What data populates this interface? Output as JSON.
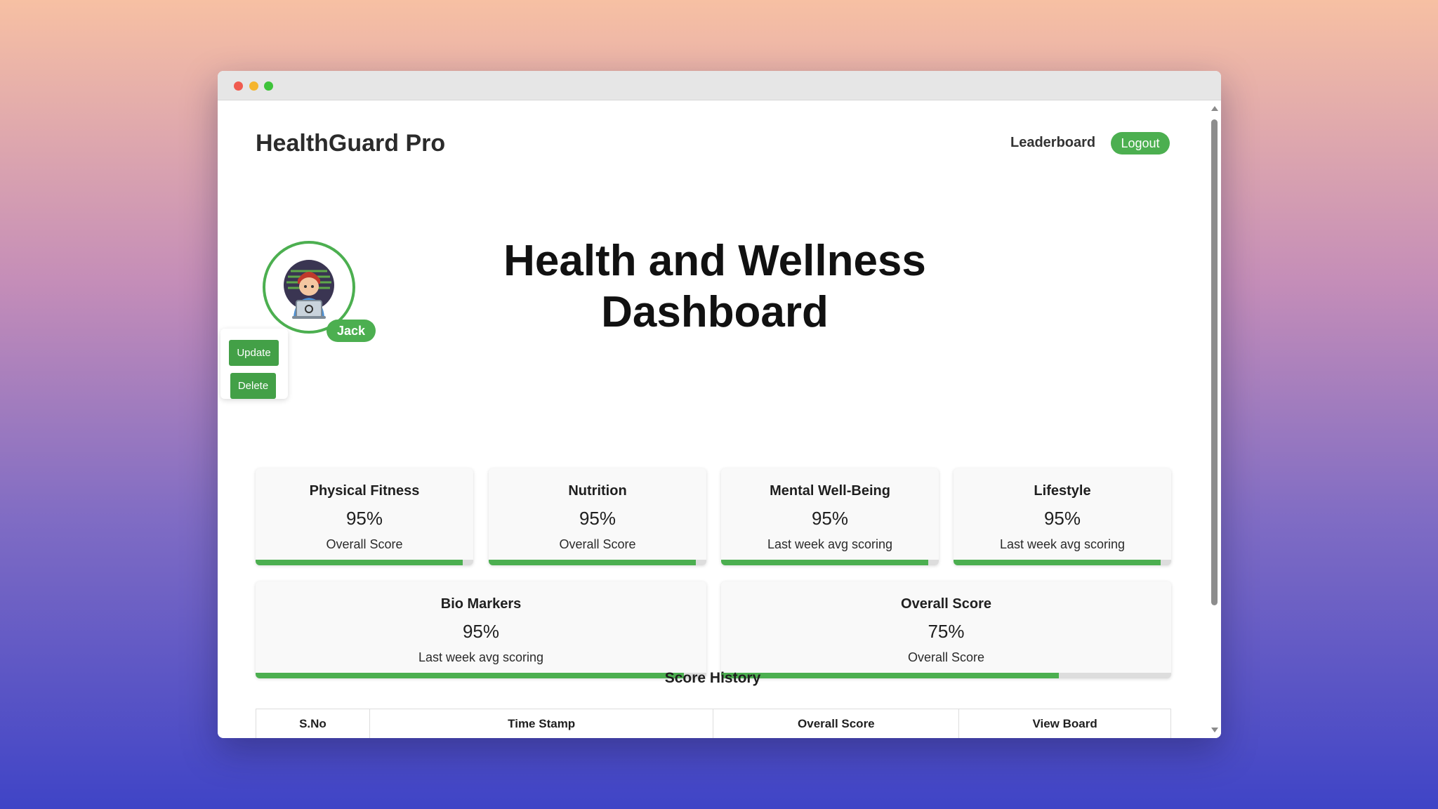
{
  "header": {
    "app_title": "HealthGuard Pro",
    "nav_leaderboard": "Leaderboard",
    "logout_label": "Logout"
  },
  "profile": {
    "name": "Jack",
    "update_label": "Update",
    "delete_label": "Delete"
  },
  "page": {
    "title_line1": "Health and Wellness",
    "title_line2": "Dashboard"
  },
  "cards": [
    {
      "title": "Physical Fitness",
      "value": "95%",
      "caption": "Overall Score",
      "progress": 0.95
    },
    {
      "title": "Nutrition",
      "value": "95%",
      "caption": "Overall Score",
      "progress": 0.95
    },
    {
      "title": "Mental Well-Being",
      "value": "95%",
      "caption": "Last week avg scoring",
      "progress": 0.95
    },
    {
      "title": "Lifestyle",
      "value": "95%",
      "caption": "Last week avg scoring",
      "progress": 0.95
    },
    {
      "title": "Bio Markers",
      "value": "95%",
      "caption": "Last week avg scoring",
      "progress": 0.95
    },
    {
      "title": "Overall Score",
      "value": "75%",
      "caption": "Overall Score",
      "progress": 0.75
    }
  ],
  "history": {
    "title": "Score History",
    "columns": [
      "S.No",
      "Time Stamp",
      "Overall Score",
      "View Board"
    ]
  },
  "colors": {
    "accent": "#4caf50"
  }
}
